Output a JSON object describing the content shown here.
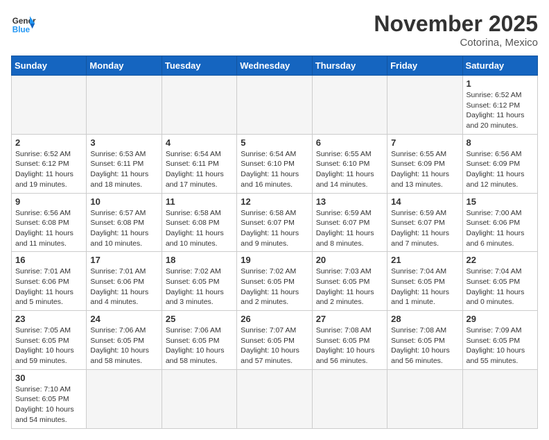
{
  "header": {
    "logo_general": "General",
    "logo_blue": "Blue",
    "month": "November 2025",
    "location": "Cotorina, Mexico"
  },
  "weekdays": [
    "Sunday",
    "Monday",
    "Tuesday",
    "Wednesday",
    "Thursday",
    "Friday",
    "Saturday"
  ],
  "days": [
    {
      "date": "",
      "info": ""
    },
    {
      "date": "",
      "info": ""
    },
    {
      "date": "",
      "info": ""
    },
    {
      "date": "",
      "info": ""
    },
    {
      "date": "",
      "info": ""
    },
    {
      "date": "",
      "info": ""
    },
    {
      "date": "1",
      "info": "Sunrise: 6:52 AM\nSunset: 6:12 PM\nDaylight: 11 hours and 20 minutes."
    },
    {
      "date": "2",
      "info": "Sunrise: 6:52 AM\nSunset: 6:12 PM\nDaylight: 11 hours and 19 minutes."
    },
    {
      "date": "3",
      "info": "Sunrise: 6:53 AM\nSunset: 6:11 PM\nDaylight: 11 hours and 18 minutes."
    },
    {
      "date": "4",
      "info": "Sunrise: 6:54 AM\nSunset: 6:11 PM\nDaylight: 11 hours and 17 minutes."
    },
    {
      "date": "5",
      "info": "Sunrise: 6:54 AM\nSunset: 6:10 PM\nDaylight: 11 hours and 16 minutes."
    },
    {
      "date": "6",
      "info": "Sunrise: 6:55 AM\nSunset: 6:10 PM\nDaylight: 11 hours and 14 minutes."
    },
    {
      "date": "7",
      "info": "Sunrise: 6:55 AM\nSunset: 6:09 PM\nDaylight: 11 hours and 13 minutes."
    },
    {
      "date": "8",
      "info": "Sunrise: 6:56 AM\nSunset: 6:09 PM\nDaylight: 11 hours and 12 minutes."
    },
    {
      "date": "9",
      "info": "Sunrise: 6:56 AM\nSunset: 6:08 PM\nDaylight: 11 hours and 11 minutes."
    },
    {
      "date": "10",
      "info": "Sunrise: 6:57 AM\nSunset: 6:08 PM\nDaylight: 11 hours and 10 minutes."
    },
    {
      "date": "11",
      "info": "Sunrise: 6:58 AM\nSunset: 6:08 PM\nDaylight: 11 hours and 10 minutes."
    },
    {
      "date": "12",
      "info": "Sunrise: 6:58 AM\nSunset: 6:07 PM\nDaylight: 11 hours and 9 minutes."
    },
    {
      "date": "13",
      "info": "Sunrise: 6:59 AM\nSunset: 6:07 PM\nDaylight: 11 hours and 8 minutes."
    },
    {
      "date": "14",
      "info": "Sunrise: 6:59 AM\nSunset: 6:07 PM\nDaylight: 11 hours and 7 minutes."
    },
    {
      "date": "15",
      "info": "Sunrise: 7:00 AM\nSunset: 6:06 PM\nDaylight: 11 hours and 6 minutes."
    },
    {
      "date": "16",
      "info": "Sunrise: 7:01 AM\nSunset: 6:06 PM\nDaylight: 11 hours and 5 minutes."
    },
    {
      "date": "17",
      "info": "Sunrise: 7:01 AM\nSunset: 6:06 PM\nDaylight: 11 hours and 4 minutes."
    },
    {
      "date": "18",
      "info": "Sunrise: 7:02 AM\nSunset: 6:05 PM\nDaylight: 11 hours and 3 minutes."
    },
    {
      "date": "19",
      "info": "Sunrise: 7:02 AM\nSunset: 6:05 PM\nDaylight: 11 hours and 2 minutes."
    },
    {
      "date": "20",
      "info": "Sunrise: 7:03 AM\nSunset: 6:05 PM\nDaylight: 11 hours and 2 minutes."
    },
    {
      "date": "21",
      "info": "Sunrise: 7:04 AM\nSunset: 6:05 PM\nDaylight: 11 hours and 1 minute."
    },
    {
      "date": "22",
      "info": "Sunrise: 7:04 AM\nSunset: 6:05 PM\nDaylight: 11 hours and 0 minutes."
    },
    {
      "date": "23",
      "info": "Sunrise: 7:05 AM\nSunset: 6:05 PM\nDaylight: 10 hours and 59 minutes."
    },
    {
      "date": "24",
      "info": "Sunrise: 7:06 AM\nSunset: 6:05 PM\nDaylight: 10 hours and 58 minutes."
    },
    {
      "date": "25",
      "info": "Sunrise: 7:06 AM\nSunset: 6:05 PM\nDaylight: 10 hours and 58 minutes."
    },
    {
      "date": "26",
      "info": "Sunrise: 7:07 AM\nSunset: 6:05 PM\nDaylight: 10 hours and 57 minutes."
    },
    {
      "date": "27",
      "info": "Sunrise: 7:08 AM\nSunset: 6:05 PM\nDaylight: 10 hours and 56 minutes."
    },
    {
      "date": "28",
      "info": "Sunrise: 7:08 AM\nSunset: 6:05 PM\nDaylight: 10 hours and 56 minutes."
    },
    {
      "date": "29",
      "info": "Sunrise: 7:09 AM\nSunset: 6:05 PM\nDaylight: 10 hours and 55 minutes."
    },
    {
      "date": "30",
      "info": "Sunrise: 7:10 AM\nSunset: 6:05 PM\nDaylight: 10 hours and 54 minutes."
    },
    {
      "date": "",
      "info": ""
    },
    {
      "date": "",
      "info": ""
    },
    {
      "date": "",
      "info": ""
    },
    {
      "date": "",
      "info": ""
    },
    {
      "date": "",
      "info": ""
    },
    {
      "date": "",
      "info": ""
    }
  ]
}
